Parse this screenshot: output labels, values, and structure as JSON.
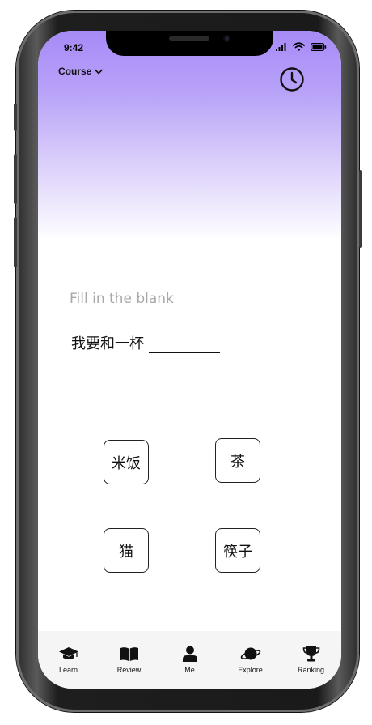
{
  "status_bar": {
    "time": "9:42"
  },
  "header": {
    "course_label": "Course",
    "history_icon": "clock-icon"
  },
  "exercise": {
    "prompt": "Fill in the blank",
    "sentence": "我要和一杯",
    "options": [
      "米饭",
      "茶",
      "猫",
      "筷子"
    ]
  },
  "tab_bar": {
    "tabs": [
      {
        "label": "Learn",
        "icon": "graduation-cap-icon"
      },
      {
        "label": "Review",
        "icon": "book-icon"
      },
      {
        "label": "Me",
        "icon": "user-icon"
      },
      {
        "label": "Explore",
        "icon": "planet-icon"
      },
      {
        "label": "Ranking",
        "icon": "trophy-icon"
      }
    ]
  },
  "colors": {
    "gradient_top": "#a68af7",
    "tab_bar_bg": "#f5f5f5"
  }
}
